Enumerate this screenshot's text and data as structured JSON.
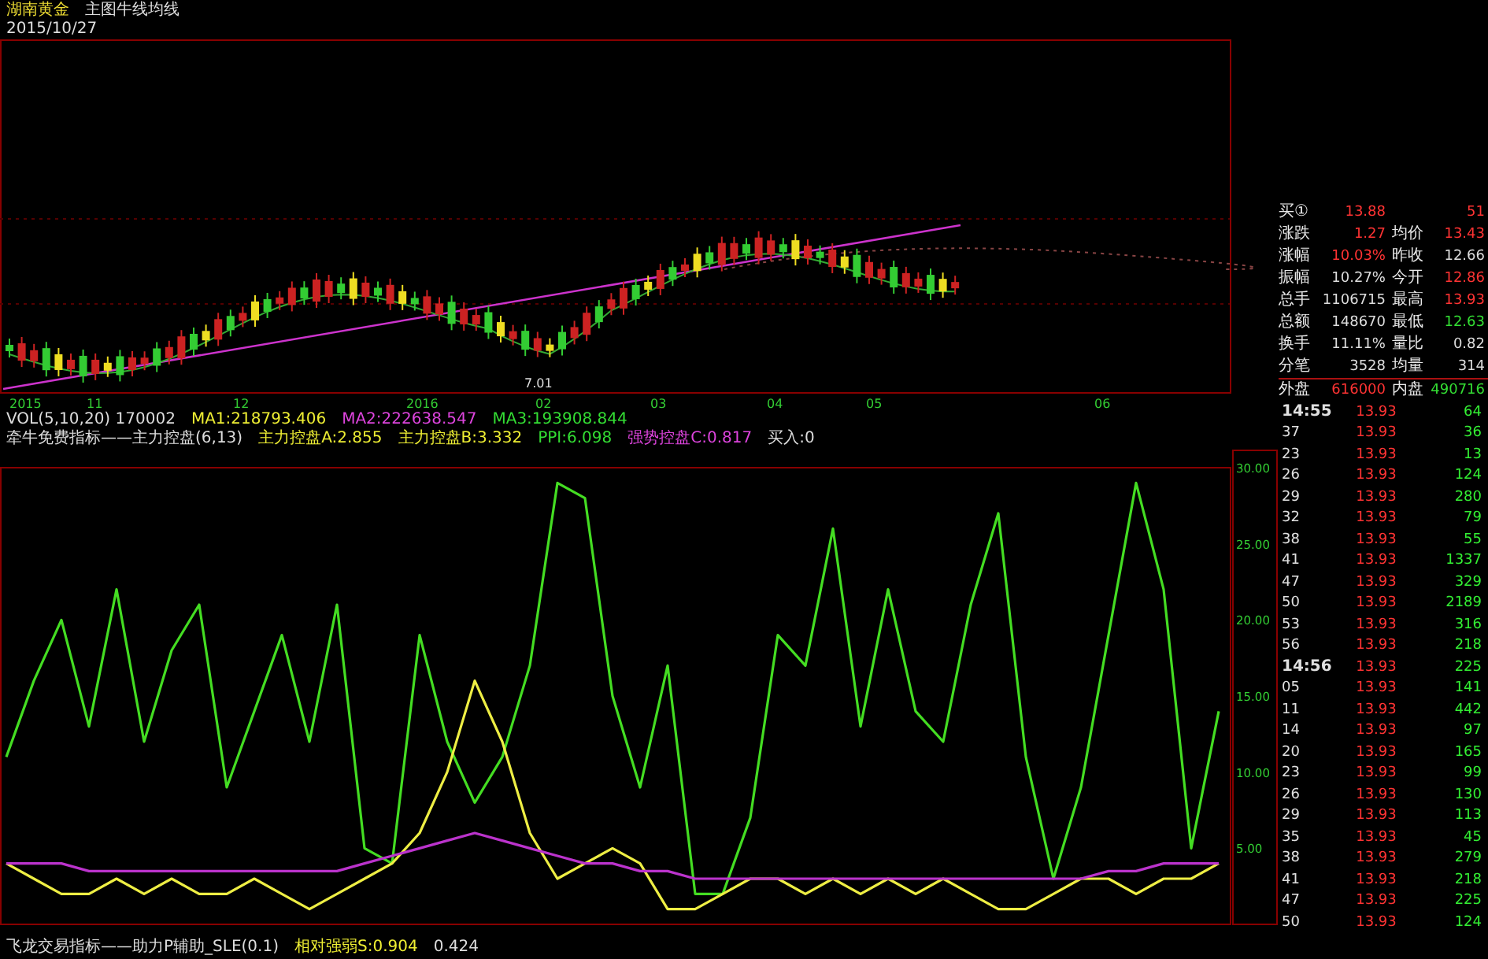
{
  "header": {
    "stock_name": "湖南黄金",
    "indicator": "主图牛线均线",
    "date": "2015/10/27"
  },
  "price_chart": {
    "x_labels": [
      "2015",
      "11",
      "12",
      "2016",
      "02",
      "03",
      "04",
      "05",
      "06"
    ],
    "low_marker": "7.01"
  },
  "indicator_lines": [
    {
      "items": [
        {
          "text": "VOL(5,10,20)  170002",
          "color": "#dddddd"
        },
        {
          "text": "MA1:218793.406",
          "color": "#eeee33"
        },
        {
          "text": "MA2:222638.547",
          "color": "#dd44dd"
        },
        {
          "text": "MA3:193908.844",
          "color": "#33dd33"
        }
      ]
    },
    {
      "items": [
        {
          "text": "牵牛免费指标——主力控盘(6,13)",
          "color": "#dddddd"
        },
        {
          "text": "主力控盘A:2.855",
          "color": "#eeee33"
        },
        {
          "text": "主力控盘B:3.332",
          "color": "#eeee33"
        },
        {
          "text": "PPI:6.098",
          "color": "#33dd33"
        },
        {
          "text": "强势控盘C:0.817",
          "color": "#dd44dd"
        },
        {
          "text": "买入:0",
          "color": "#dddddd"
        }
      ]
    }
  ],
  "oscillator": {
    "chart_data": {
      "type": "line",
      "ylim": [
        0,
        30
      ],
      "yticks": [
        {
          "value": 5,
          "label": "5.00"
        },
        {
          "value": 10,
          "label": "10.00"
        },
        {
          "value": 15,
          "label": "15.00"
        },
        {
          "value": 20,
          "label": "20.00"
        },
        {
          "value": 25,
          "label": "25.00"
        },
        {
          "value": 30,
          "label": "30.00"
        }
      ],
      "series": [
        {
          "color": "#44dd22",
          "values": [
            11,
            16,
            20,
            13,
            22,
            12,
            18,
            21,
            9,
            14,
            19,
            12,
            21,
            5,
            4,
            19,
            12,
            8,
            11,
            17,
            29,
            28,
            15,
            9,
            17,
            2,
            2,
            7,
            19,
            17,
            26,
            13,
            22,
            14,
            12,
            21,
            27,
            11,
            3,
            9,
            19,
            29,
            22,
            5,
            14
          ]
        },
        {
          "color": "#eeee44",
          "values": [
            4,
            3,
            2,
            2,
            3,
            2,
            3,
            2,
            2,
            3,
            2,
            1,
            2,
            3,
            4,
            6,
            10,
            16,
            12,
            6,
            3,
            4,
            5,
            4,
            1,
            1,
            2,
            3,
            3,
            2,
            3,
            2,
            3,
            2,
            3,
            2,
            1,
            1,
            2,
            3,
            3,
            2,
            3,
            3,
            4
          ]
        },
        {
          "color": "#bb33cc",
          "values": [
            4,
            4,
            4,
            3.5,
            3.5,
            3.5,
            3.5,
            3.5,
            3.5,
            3.5,
            3.5,
            3.5,
            3.5,
            4,
            4.5,
            5,
            5.5,
            6,
            5.5,
            5,
            4.5,
            4,
            4,
            3.5,
            3.5,
            3,
            3,
            3,
            3,
            3,
            3,
            3,
            3,
            3,
            3,
            3,
            3,
            3,
            3,
            3,
            3.5,
            3.5,
            4,
            4,
            4
          ]
        }
      ]
    }
  },
  "status_bar": [
    {
      "text": "飞龙交易指标——助力P辅助_SLE(0.1)",
      "color": "#dddddd"
    },
    {
      "text": "相对强弱S:0.904",
      "color": "#eeee33"
    },
    {
      "text": "0.424",
      "color": "#dddddd"
    }
  ],
  "quote": [
    {
      "label": "买①",
      "value": {
        "text": "13.88",
        "color": "#ff3333"
      },
      "value2": {
        "text": "51",
        "color": "#ff3333"
      }
    },
    {
      "label": "涨跌",
      "value": {
        "text": "1.27",
        "color": "#ff3333"
      },
      "label2": "均价",
      "value2": {
        "text": "13.43",
        "color": "#ff3333"
      }
    },
    {
      "label": "涨幅",
      "value": {
        "text": "10.03%",
        "color": "#ff3333"
      },
      "label2": "昨收",
      "value2": {
        "text": "12.66",
        "color": "#dddddd"
      }
    },
    {
      "label": "振幅",
      "value": {
        "text": "10.27%",
        "color": "#dddddd"
      },
      "label2": "今开",
      "value2": {
        "text": "12.86",
        "color": "#ff3333"
      }
    },
    {
      "label": "总手",
      "value": {
        "text": "1106715",
        "color": "#dddddd"
      },
      "label2": "最高",
      "value2": {
        "text": "13.93",
        "color": "#ff3333"
      }
    },
    {
      "label": "总额",
      "value": {
        "text": "148670",
        "color": "#dddddd"
      },
      "label2": "最低",
      "value2": {
        "text": "12.63",
        "color": "#33dd33"
      }
    },
    {
      "label": "换手",
      "value": {
        "text": "11.11%",
        "color": "#dddddd"
      },
      "label2": "量比",
      "value2": {
        "text": "0.82",
        "color": "#dddddd"
      }
    },
    {
      "label": "分笔",
      "value": {
        "text": "3528",
        "color": "#dddddd"
      },
      "label2": "均量",
      "value2": {
        "text": "314",
        "color": "#dddddd"
      }
    },
    {
      "label": "外盘",
      "value": {
        "text": "616000",
        "color": "#ff3333"
      },
      "label2": "内盘",
      "value2": {
        "text": "490716",
        "color": "#33dd33"
      }
    }
  ],
  "ticks": [
    {
      "time": "14:55",
      "price": "13.93",
      "volume": "64"
    },
    {
      "time": "37",
      "price": "13.93",
      "volume": "36"
    },
    {
      "time": "23",
      "price": "13.93",
      "volume": "13"
    },
    {
      "time": "26",
      "price": "13.93",
      "volume": "124"
    },
    {
      "time": "29",
      "price": "13.93",
      "volume": "280"
    },
    {
      "time": "32",
      "price": "13.93",
      "volume": "79"
    },
    {
      "time": "38",
      "price": "13.93",
      "volume": "55"
    },
    {
      "time": "41",
      "price": "13.93",
      "volume": "1337"
    },
    {
      "time": "47",
      "price": "13.93",
      "volume": "329"
    },
    {
      "time": "50",
      "price": "13.93",
      "volume": "2189"
    },
    {
      "time": "53",
      "price": "13.93",
      "volume": "316"
    },
    {
      "time": "56",
      "price": "13.93",
      "volume": "218"
    },
    {
      "time": "14:56",
      "price": "13.93",
      "volume": "225"
    },
    {
      "time": "05",
      "price": "13.93",
      "volume": "141"
    },
    {
      "time": "11",
      "price": "13.93",
      "volume": "442"
    },
    {
      "time": "14",
      "price": "13.93",
      "volume": "97"
    },
    {
      "time": "20",
      "price": "13.93",
      "volume": "165"
    },
    {
      "time": "23",
      "price": "13.93",
      "volume": "99"
    },
    {
      "time": "26",
      "price": "13.93",
      "volume": "130"
    },
    {
      "time": "29",
      "price": "13.93",
      "volume": "113"
    },
    {
      "time": "35",
      "price": "13.93",
      "volume": "45"
    },
    {
      "time": "38",
      "price": "13.93",
      "volume": "279"
    },
    {
      "time": "41",
      "price": "13.93",
      "volume": "218"
    },
    {
      "time": "47",
      "price": "13.93",
      "volume": "225"
    },
    {
      "time": "50",
      "price": "13.93",
      "volume": "124"
    }
  ]
}
